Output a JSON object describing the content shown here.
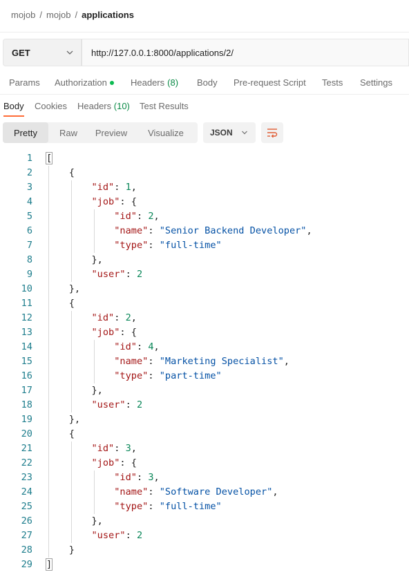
{
  "breadcrumb": {
    "part1": "mojob",
    "sep1": "/",
    "part2": "mojob",
    "sep2": "/",
    "current": "applications"
  },
  "request": {
    "method": "GET",
    "url": "http://127.0.0.1:8000/applications/2/"
  },
  "request_tabs": {
    "params": "Params",
    "authorization": "Authorization",
    "headers": "Headers",
    "headers_count": "(8)",
    "body": "Body",
    "pre_request": "Pre-request Script",
    "tests": "Tests",
    "settings": "Settings"
  },
  "response_tabs": {
    "body": "Body",
    "cookies": "Cookies",
    "headers": "Headers",
    "headers_count": "(10)",
    "test_results": "Test Results"
  },
  "view": {
    "pretty": "Pretty",
    "raw": "Raw",
    "preview": "Preview",
    "visualize": "Visualize",
    "format": "JSON"
  },
  "colors": {
    "accent": "#ff6c37",
    "auth_dot": "#0cbb52",
    "line_numbers": "#1d7d8c",
    "json_key": "#a31515",
    "json_number": "#098658",
    "json_string": "#0451a5"
  },
  "code_lines": [
    [
      {
        "t": "["
      }
    ],
    [
      {
        "t": "    {"
      }
    ],
    [
      {
        "t": "        "
      },
      {
        "t": "\"id\"",
        "c": "k"
      },
      {
        "t": ": "
      },
      {
        "t": "1",
        "c": "n"
      },
      {
        "t": ","
      }
    ],
    [
      {
        "t": "        "
      },
      {
        "t": "\"job\"",
        "c": "k"
      },
      {
        "t": ": {"
      }
    ],
    [
      {
        "t": "            "
      },
      {
        "t": "\"id\"",
        "c": "k"
      },
      {
        "t": ": "
      },
      {
        "t": "2",
        "c": "n"
      },
      {
        "t": ","
      }
    ],
    [
      {
        "t": "            "
      },
      {
        "t": "\"name\"",
        "c": "k"
      },
      {
        "t": ": "
      },
      {
        "t": "\"Senior Backend Developer\"",
        "c": "s"
      },
      {
        "t": ","
      }
    ],
    [
      {
        "t": "            "
      },
      {
        "t": "\"type\"",
        "c": "k"
      },
      {
        "t": ": "
      },
      {
        "t": "\"full-time\"",
        "c": "s"
      }
    ],
    [
      {
        "t": "        },"
      }
    ],
    [
      {
        "t": "        "
      },
      {
        "t": "\"user\"",
        "c": "k"
      },
      {
        "t": ": "
      },
      {
        "t": "2",
        "c": "n"
      }
    ],
    [
      {
        "t": "    },"
      }
    ],
    [
      {
        "t": "    {"
      }
    ],
    [
      {
        "t": "        "
      },
      {
        "t": "\"id\"",
        "c": "k"
      },
      {
        "t": ": "
      },
      {
        "t": "2",
        "c": "n"
      },
      {
        "t": ","
      }
    ],
    [
      {
        "t": "        "
      },
      {
        "t": "\"job\"",
        "c": "k"
      },
      {
        "t": ": {"
      }
    ],
    [
      {
        "t": "            "
      },
      {
        "t": "\"id\"",
        "c": "k"
      },
      {
        "t": ": "
      },
      {
        "t": "4",
        "c": "n"
      },
      {
        "t": ","
      }
    ],
    [
      {
        "t": "            "
      },
      {
        "t": "\"name\"",
        "c": "k"
      },
      {
        "t": ": "
      },
      {
        "t": "\"Marketing Specialist\"",
        "c": "s"
      },
      {
        "t": ","
      }
    ],
    [
      {
        "t": "            "
      },
      {
        "t": "\"type\"",
        "c": "k"
      },
      {
        "t": ": "
      },
      {
        "t": "\"part-time\"",
        "c": "s"
      }
    ],
    [
      {
        "t": "        },"
      }
    ],
    [
      {
        "t": "        "
      },
      {
        "t": "\"user\"",
        "c": "k"
      },
      {
        "t": ": "
      },
      {
        "t": "2",
        "c": "n"
      }
    ],
    [
      {
        "t": "    },"
      }
    ],
    [
      {
        "t": "    {"
      }
    ],
    [
      {
        "t": "        "
      },
      {
        "t": "\"id\"",
        "c": "k"
      },
      {
        "t": ": "
      },
      {
        "t": "3",
        "c": "n"
      },
      {
        "t": ","
      }
    ],
    [
      {
        "t": "        "
      },
      {
        "t": "\"job\"",
        "c": "k"
      },
      {
        "t": ": {"
      }
    ],
    [
      {
        "t": "            "
      },
      {
        "t": "\"id\"",
        "c": "k"
      },
      {
        "t": ": "
      },
      {
        "t": "3",
        "c": "n"
      },
      {
        "t": ","
      }
    ],
    [
      {
        "t": "            "
      },
      {
        "t": "\"name\"",
        "c": "k"
      },
      {
        "t": ": "
      },
      {
        "t": "\"Software Developer\"",
        "c": "s"
      },
      {
        "t": ","
      }
    ],
    [
      {
        "t": "            "
      },
      {
        "t": "\"type\"",
        "c": "k"
      },
      {
        "t": ": "
      },
      {
        "t": "\"full-time\"",
        "c": "s"
      }
    ],
    [
      {
        "t": "        },"
      }
    ],
    [
      {
        "t": "        "
      },
      {
        "t": "\"user\"",
        "c": "k"
      },
      {
        "t": ": "
      },
      {
        "t": "2",
        "c": "n"
      }
    ],
    [
      {
        "t": "    }"
      }
    ],
    [
      {
        "t": "]"
      }
    ]
  ]
}
